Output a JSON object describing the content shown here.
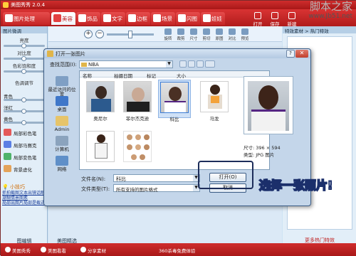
{
  "app": {
    "title": "美图秀秀 2.0.4"
  },
  "tabs": [
    {
      "label": "图片处理",
      "active": false
    },
    {
      "label": "美容",
      "active": true
    },
    {
      "label": "饰品",
      "active": false
    },
    {
      "label": "文字",
      "active": false
    },
    {
      "label": "边框",
      "active": false
    },
    {
      "label": "场景",
      "active": false
    },
    {
      "label": "闪图",
      "active": false
    },
    {
      "label": "娃娃",
      "active": false
    }
  ],
  "toolbar": {
    "open": "打开",
    "save": "保存",
    "new": "新建"
  },
  "watermark": {
    "line1": "脚本之家",
    "line2": "www.Jb51.net"
  },
  "left": {
    "title": "图片微调",
    "sliders": [
      "亮度",
      "对比度",
      "色彩饱和度",
      "色调调节"
    ],
    "rgb": [
      "青色",
      "洋红",
      "黄色"
    ],
    "effects": [
      "局部彩色笔",
      "局部马赛克",
      "局部变色笔",
      "背景虚化"
    ],
    "tips_head": "小技巧",
    "tips": [
      "抓拍截图文本出镜话眼",
      "潮糊情景图素",
      "局部出图片局部是截式"
    ],
    "bottom": "图编辑"
  },
  "canvas": {
    "tools": [
      "旋转",
      "裁剪",
      "尺寸",
      "剪切",
      "原图",
      "对比",
      "预览"
    ],
    "bottom": "美图精选"
  },
  "right": {
    "title": "特效素材 > 热门特效",
    "bottom": "更多热门特效"
  },
  "status": {
    "items": [
      "美图秀秀",
      "美图看看",
      "分享素材"
    ],
    "center": "360杀毒免费体验"
  },
  "dialog": {
    "title": "打开一张图片",
    "help": "?",
    "close": "✕",
    "lookin_label": "查找范围(I):",
    "lookin_value": "NBA",
    "places": [
      "最近访问的位置",
      "桌面",
      "Admin",
      "计算机",
      "网络"
    ],
    "columns": [
      "名称",
      "拍摄日期",
      "标记",
      "大小"
    ],
    "files": [
      {
        "name": "奥尼尔",
        "selected": false
      },
      {
        "name": "菲尔杰克逊",
        "selected": false
      },
      {
        "name": "科比",
        "selected": true
      },
      {
        "name": "马龙",
        "selected": false
      },
      {
        "name": "",
        "selected": false
      },
      {
        "name": "",
        "selected": false
      }
    ],
    "filename_label": "文件名(N):",
    "filename_value": "科比",
    "filetype_label": "文件类型(T):",
    "filetype_value": "所有支持的图片格式",
    "open_button": "打开(O)",
    "cancel_button": "取消",
    "info_size": "尺寸:  396 × 594",
    "info_type": "类型:  JPG 图片"
  },
  "callout": "选择一张照片!",
  "colors": {
    "brand": "#c52626",
    "accent": "#e34141",
    "selection": "#cfe1f7"
  }
}
